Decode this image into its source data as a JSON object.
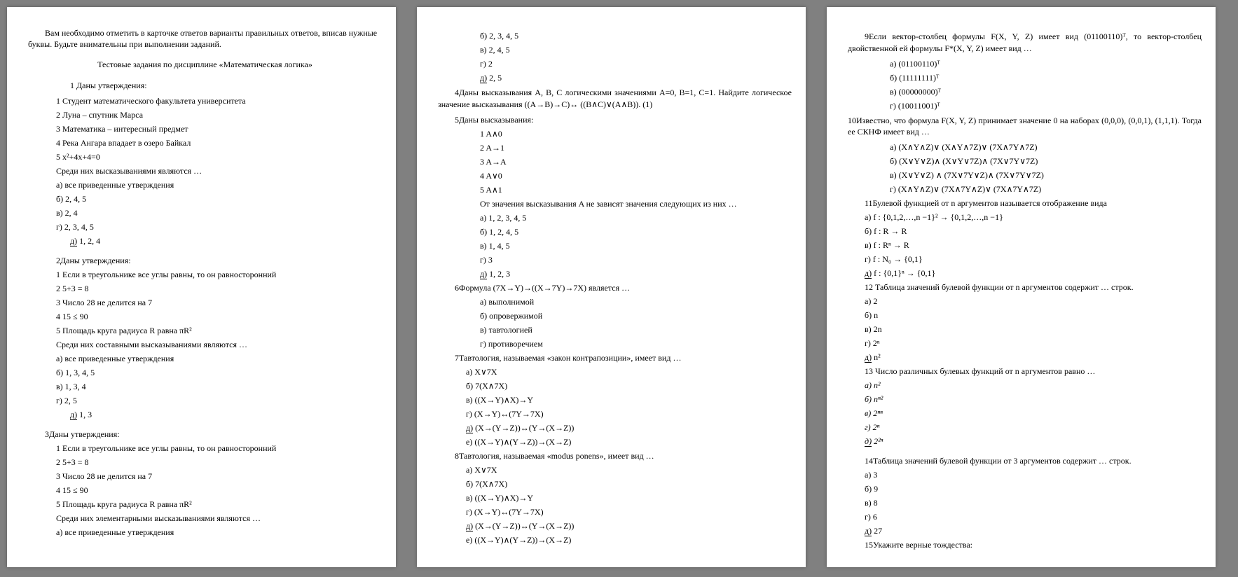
{
  "intro": "Вам необходимо отметить в карточке ответов варианты правильных ответов, вписав нужные буквы. Будьте внимательны при выполнении заданий.",
  "title": "Тестовые задания по дисциплине «Математическая логика»",
  "p1": {
    "q1": {
      "head": "1 Даны утверждения:",
      "s1": "1 Студент математического факультета университета",
      "s2": "2 Луна – спутник Марса",
      "s3": "3 Математика – интересный предмет",
      "s4": "4 Река Ангара впадает в озеро Байкал",
      "s5": "5 x²+4x+4=0",
      "tail": "Среди них высказываниями являются …",
      "a": "а) все приведенные утверждения",
      "b": "б) 2, 4, 5",
      "c": "в) 2, 4",
      "d": "г) 2, 3, 4, 5",
      "e_lbl": "д)",
      "e_txt": " 1, 2, 4"
    },
    "q2": {
      "head": "2Даны утверждения:",
      "s1": "1 Если в треугольнике все углы равны, то он равносторонний",
      "s2": "2 5+3 = 8",
      "s3": "3 Число 28 не делится на 7",
      "s4": "4 15 ≤ 90",
      "s5": "5 Площадь круга радиуса R равна πR²",
      "tail": "Среди них составными высказываниями являются …",
      "a": "а) все приведенные утверждения",
      "b": "б) 1, 3, 4, 5",
      "c": "в) 1, 3, 4",
      "d": "г) 2, 5",
      "e_lbl": "д)",
      "e_txt": " 1, 3"
    },
    "q3": {
      "head": "3Даны утверждения:",
      "s1": "1 Если в треугольнике все углы равны, то он равносторонний",
      "s2": "2 5+3 = 8",
      "s3": "3 Число 28 не делится на 7",
      "s4": "4 15 ≤ 90",
      "s5": "5 Площадь круга радиуса R равна πR²",
      "tail": "Среди них элементарными высказываниями являются …",
      "a": "а) все приведенные утверждения"
    }
  },
  "p2": {
    "cont": {
      "b": "б) 2, 3, 4, 5",
      "c": "в) 2, 4, 5",
      "d": "г) 2",
      "e_lbl": "д)",
      "e_txt": " 2, 5"
    },
    "q4": "4Даны высказывания A, B, C логическими значениями A=0, B=1, C=1. Найдите логическое значение высказывания ((A→B)→C)↔ ((B∧C)∨(A∧B)). (1)",
    "q5": {
      "head": "5Даны высказывания:",
      "s1": "1 A∧0",
      "s2": "2 A→1",
      "s3": "3 A→A",
      "s4": "4 A∨0",
      "s5": "5 A∧1",
      "tail": "От значения высказывания A не зависят значения следующих из них …",
      "a": "а) 1, 2, 3, 4, 5",
      "b": "б) 1, 2, 4, 5",
      "c": "в) 1, 4, 5",
      "d": "г) 3",
      "e_lbl": "д)",
      "e_txt": " 1, 2, 3"
    },
    "q6": {
      "head": "6Формула (7X→Y)→((X→7Y)→7X) является …",
      "a": "а) выполнимой",
      "b": "б) опровержимой",
      "c": "в) тавтологией",
      "d": "г) противоречием"
    },
    "q7": {
      "head": "7Тавтология, называемая «закон контрапозиции», имеет вид …",
      "a": "а) X∨7X",
      "b": "б) 7(X∧7X)",
      "c": "в) ((X→Y)∧X)→Y",
      "d": "г) (X→Y)↔(7Y→7X)",
      "e_lbl": "д)",
      "e_txt": " (X→(Y→Z))↔(Y→(X→Z))",
      "f": "е) ((X→Y)∧(Y→Z))→(X→Z)"
    },
    "q8": {
      "head": "8Тавтология, называемая «modus ponens», имеет вид …",
      "a": "а) X∨7X",
      "b": "б) 7(X∧7X)",
      "c": "в) ((X→Y)∧X)→Y",
      "d": "г) (X→Y)↔(7Y→7X)",
      "e_lbl": "д)",
      "e_txt": " (X→(Y→Z))↔(Y→(X→Z))",
      "f": "е) ((X→Y)∧(Y→Z))→(X→Z)"
    }
  },
  "p3": {
    "q9": {
      "head": "9Если вектор-столбец формулы F(X, Y, Z) имеет вид (01100110)ᵀ, то вектор-столбец двойственной ей формулы F*(X, Y, Z) имеет вид …",
      "a": "а) (01100110)ᵀ",
      "b": "б) (11111111)ᵀ",
      "c": "в) (00000000)ᵀ",
      "d": "г) (10011001)ᵀ"
    },
    "q10": {
      "head": "10Известно, что формула F(X, Y, Z) принимает значение 0 на наборах (0,0,0), (0,0,1), (1,1,1). Тогда ее СКНФ имеет вид …",
      "a": "а) (X∧Y∧Z)∨ (X∧Y∧7Z)∨ (7X∧7Y∧7Z)",
      "b": "б) (X∨Y∨Z)∧ (X∨Y∨7Z)∧ (7X∨7Y∨7Z)",
      "c": "в) (X∨Y∨Z) ∧ (7X∨7Y∨Z)∧ (7X∨7Y∨7Z)",
      "d": "г) (X∧Y∧Z)∨ (7X∧7Y∧Z)∨ (7X∧7Y∧7Z)"
    },
    "q11": {
      "head": "11Булевой функцией от n аргументов называется отображение вида",
      "a": "а) f : {0,1,2,…,n −1}² → {0,1,2,…,n −1}",
      "b": "б)  f : R → R",
      "c": "в) f : Rⁿ → R",
      "d": "г) f : N₀  → {0,1}",
      "e_lbl": "д)",
      "e_txt": " f : {0,1}ⁿ → {0,1}"
    },
    "q12": {
      "head": "12 Таблица значений булевой функции от n аргументов содержит … строк.",
      "a": "а) 2",
      "b": "б) n",
      "c": "в) 2n",
      "d": "г) 2ⁿ",
      "e_lbl": "д)",
      "e_txt": " n²"
    },
    "q13": {
      "head": "13 Число различных булевых функций от n аргументов равно …",
      "a": "а) n²",
      "b": "б) nⁿ²",
      "c": "в) 2ⁿⁿ",
      "d": "г) 2ⁿ",
      "e_lbl": "д)",
      "e_txt": " 2²ⁿ"
    },
    "q14": {
      "head": "14Таблица значений булевой функции от 3 аргументов содержит … строк.",
      "a": "а) 3",
      "b": "б) 9",
      "c": "в) 8",
      "d": "г) 6",
      "e_lbl": "д)",
      "e_txt": " 27"
    },
    "q15": "15Укажите верные тождества:"
  }
}
